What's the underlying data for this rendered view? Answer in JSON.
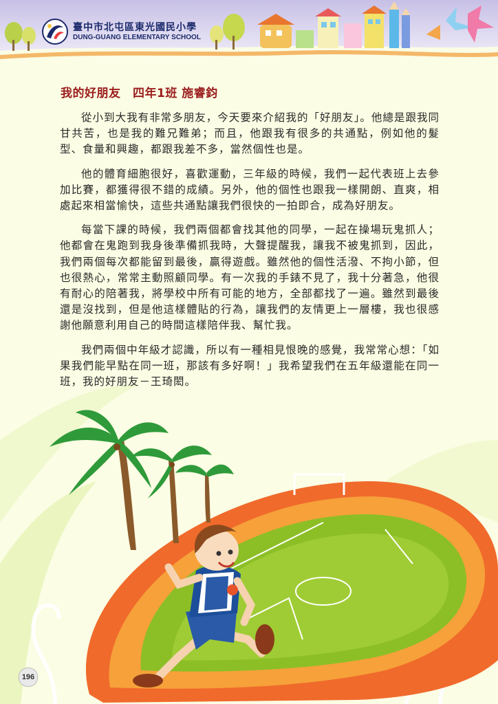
{
  "header": {
    "school_name_zh": "臺中市北屯區東光國民小學",
    "school_name_en": "DUNG-GUANG ELEMENTARY SCHOOL"
  },
  "article": {
    "title": "我的好朋友　四年1班 施睿鈞",
    "paragraphs": [
      "從小到大我有非常多朋友，今天要來介紹我的「好朋友」。他總是跟我同甘共苦，也是我的難兄難弟；而且，他跟我有很多的共通點，例如他的髮型、食量和興趣，都跟我差不多，當然個性也是。",
      "他的體育細胞很好，喜歡運動，三年級的時候，我們一起代表班上去參加比賽，都獲得很不錯的成績。另外，他的個性也跟我一樣開朗、直爽，相處起來相當愉快，這些共通點讓我們很快的一拍即合，成為好朋友。",
      "每當下課的時候，我們兩個都會找其他的同學，一起在操場玩鬼抓人；他都會在鬼跑到我身後準備抓我時，大聲提醒我，讓我不被鬼抓到，因此，我們兩個每次都能留到最後，贏得遊戲。雖然他的個性活潑、不拘小節，但也很熱心，常常主動照顧同學。有一次我的手錶不見了，我十分著急，他很有耐心的陪著我，將學校中所有可能的地方，全部都找了一遍。雖然到最後還是沒找到，但是他這樣體貼的行為，讓我們的友情更上一層樓，我也很感謝他願意利用自己的時間這樣陪伴我、幫忙我。",
      "我們兩個中年級才認識，所以有一種相見恨晚的感覺，我常常心想：「如果我們能早點在同一班，那該有多好啊！」我希望我們在五年級還能在同一班，我的好朋友－王琦閎。"
    ]
  },
  "page_number": "196"
}
